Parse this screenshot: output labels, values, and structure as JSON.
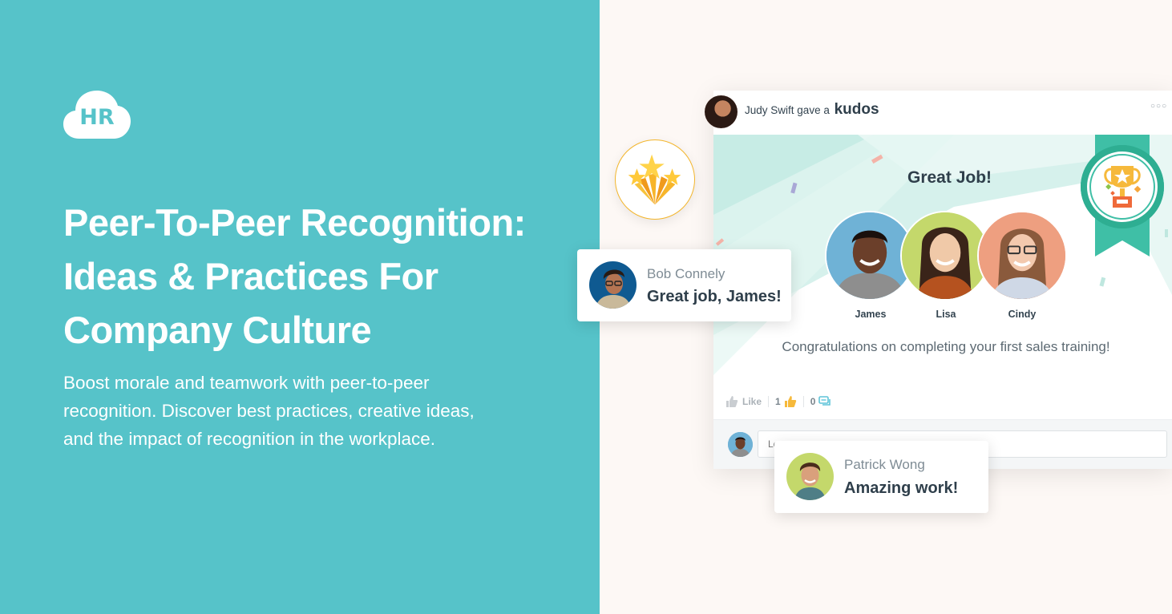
{
  "brand": {
    "logo_text": "HR",
    "primary_color": "#56c3c9",
    "accent_teal": "#3fbfa6",
    "gold": "#f3b52b"
  },
  "hero": {
    "headline_lines": [
      "Peer-To-Peer Recognition:",
      "Ideas & Practices For",
      "Company Culture"
    ],
    "subtext_lines": [
      "Boost morale and teamwork with peer-to-peer",
      "recognition. Discover best practices, creative ideas,",
      "and the impact of recognition in the workplace."
    ]
  },
  "feed_card": {
    "giver": "Judy Swift",
    "action_text": "gave a",
    "award_type": "kudos",
    "more_icon": "ellipsis-icon",
    "banner_title": "Great Job!",
    "recipients": [
      {
        "name": "James",
        "bg": "#6fb2d6"
      },
      {
        "name": "Lisa",
        "bg": "#c4d86b"
      },
      {
        "name": "Cindy",
        "bg": "#ee9f80"
      }
    ],
    "message": "Congratulations on completing your first sales training!",
    "reactions": {
      "like_label": "Like",
      "like_count": "1",
      "comment_count": "0"
    },
    "comment_placeholder": "Leave a comment..."
  },
  "toasts": [
    {
      "name": "Bob Connely",
      "message": "Great job, James!",
      "avatar_bg": "#0f5a91"
    },
    {
      "name": "Patrick Wong",
      "message": "Amazing work!",
      "avatar_bg": "#c4d86b"
    }
  ]
}
